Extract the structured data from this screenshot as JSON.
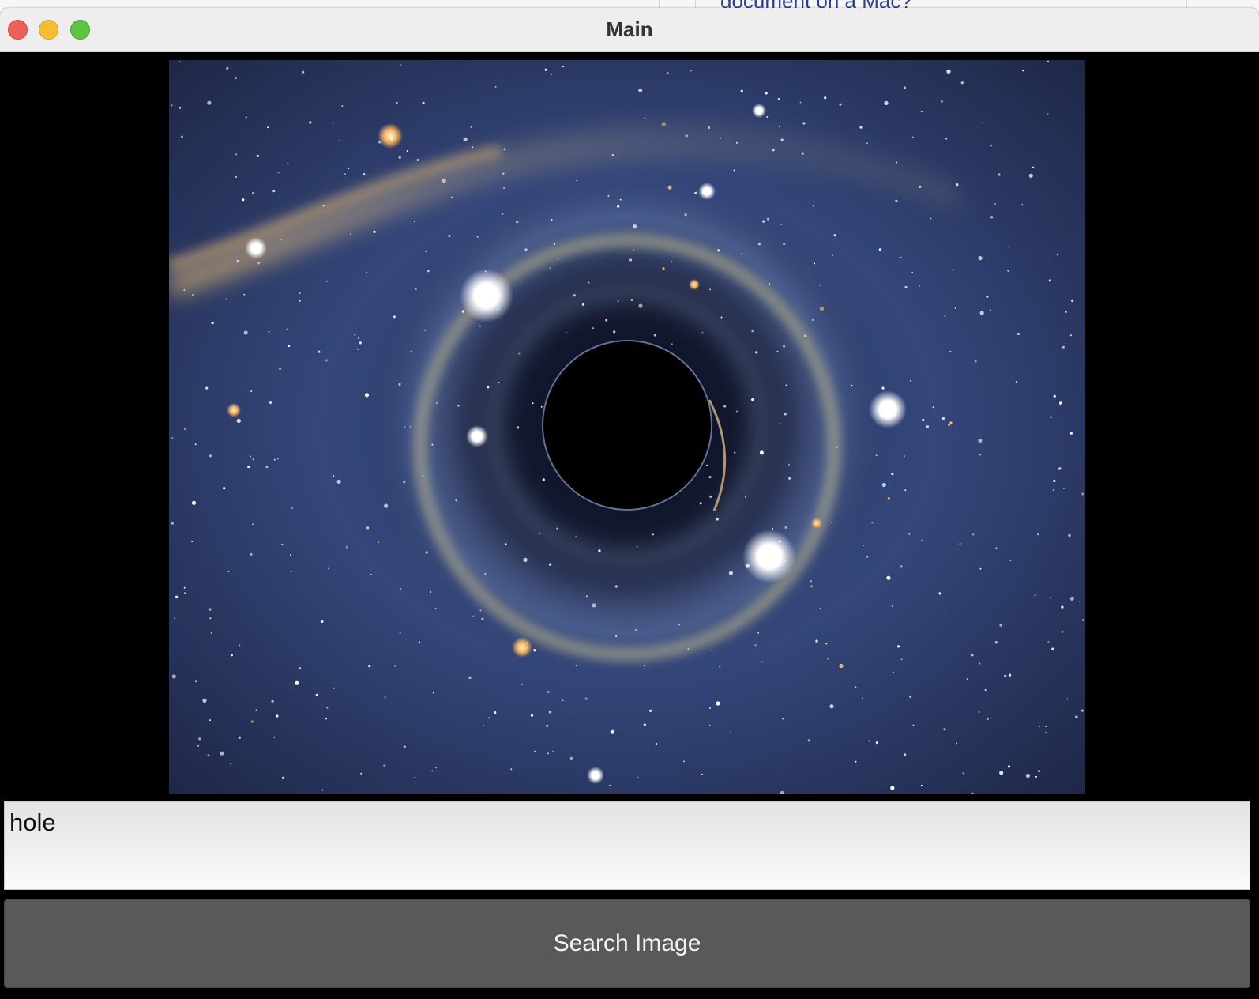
{
  "window": {
    "title": "Main"
  },
  "backdrop": {
    "partial_text": "document on a Mac?"
  },
  "image": {
    "subject": "black hole with gravitational lensing of a starfield",
    "colors": {
      "sky": "#2b3a63",
      "shadow": "#000000",
      "ring": "#b8b48a",
      "milky_way": "#c9a46e"
    }
  },
  "search": {
    "value": "hole"
  },
  "button": {
    "label": "Search Image"
  },
  "colors": {
    "close": "#ee5f57",
    "minimize": "#f5bd2f",
    "zoom": "#5fc43f",
    "button_bg": "#595959",
    "window_bg": "#000000"
  }
}
